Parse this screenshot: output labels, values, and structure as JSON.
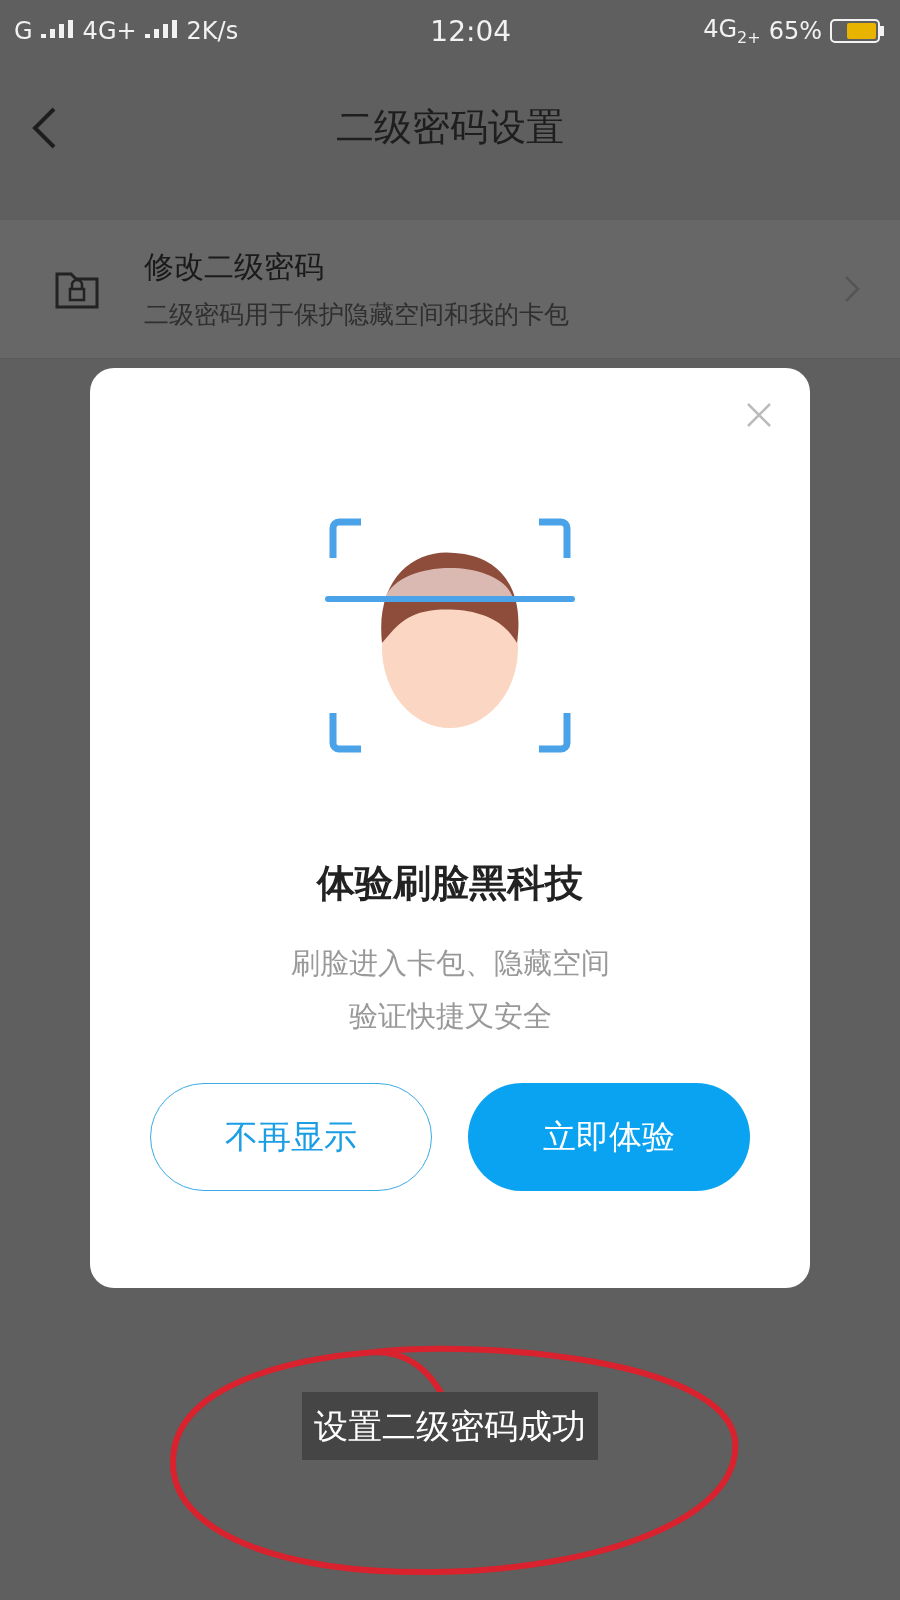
{
  "status_bar": {
    "carrier": "G",
    "network": "4G+",
    "speed": "2K/s",
    "time": "12:04",
    "network_2": "4G",
    "sim": "2+",
    "battery": "65%"
  },
  "header": {
    "title": "二级密码设置"
  },
  "settings": [
    {
      "title": "修改二级密码",
      "subtitle": "二级密码用于保护隐藏空间和我的卡包"
    }
  ],
  "dialog": {
    "title": "体验刷脸黑科技",
    "lines": [
      "刷脸进入卡包、隐藏空间",
      "验证快捷又安全"
    ],
    "buttons": [
      {
        "label": "不再显示",
        "kind": "outline"
      },
      {
        "label": "立即体验",
        "kind": "primary"
      }
    ]
  },
  "toast": "设置二级密码成功"
}
